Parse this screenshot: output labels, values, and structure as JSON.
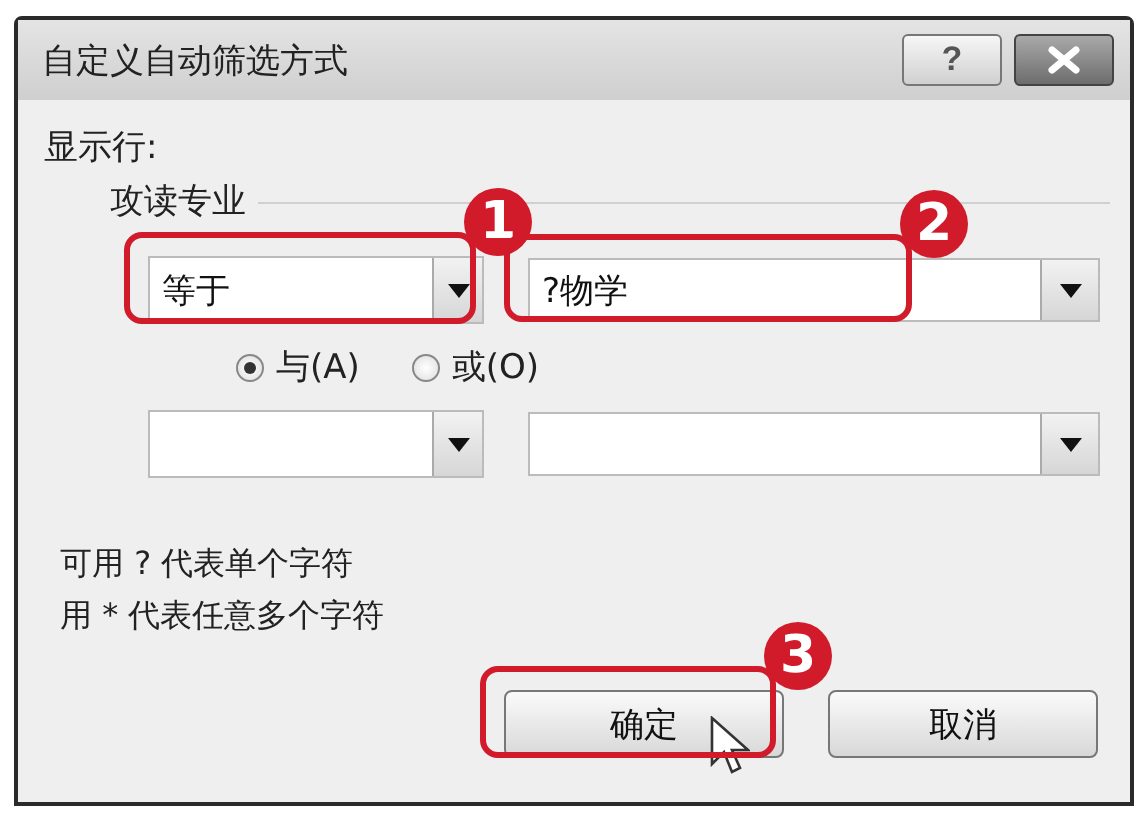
{
  "window": {
    "title": "自定义自动筛选方式",
    "buttons": [
      {
        "kind": "help",
        "label": "?"
      },
      {
        "kind": "close"
      }
    ]
  },
  "caption": "显示行:",
  "group": {
    "label": "攻读专业"
  },
  "conditions": [
    {
      "operator": "等于",
      "value": "?物学",
      "operator_callout": "1",
      "value_callout": "2"
    }
  ],
  "blank_condition_row": true,
  "join": [
    {
      "label": "与(A)",
      "selected": true
    },
    {
      "label": "或(O)",
      "selected": false
    }
  ],
  "hints": [
    "可用 ? 代表单个字符",
    "用 * 代表任意多个字符"
  ],
  "buttons": [
    {
      "kind": "ok",
      "label": "确定",
      "pointer": true,
      "callout": "3"
    },
    {
      "kind": "cancel",
      "label": "取消",
      "pointer": false
    }
  ]
}
